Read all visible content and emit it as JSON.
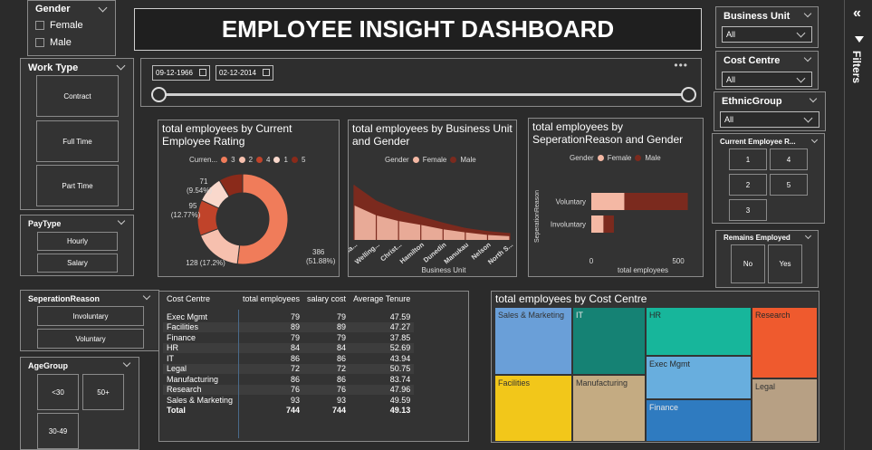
{
  "title": "EMPLOYEE INSIGHT DASHBOARD",
  "filters_pane": {
    "label": "Filters"
  },
  "gender": {
    "title": "Gender",
    "options": [
      "Female",
      "Male"
    ]
  },
  "work_type": {
    "title": "Work Type",
    "options": [
      "Contract",
      "Full Time",
      "Part Time"
    ]
  },
  "pay_type": {
    "title": "PayType",
    "options": [
      "Hourly",
      "Salary"
    ]
  },
  "separation_slicer": {
    "title": "SeperationReason",
    "options": [
      "Involuntary",
      "Voluntary"
    ]
  },
  "age_group": {
    "title": "AgeGroup",
    "options": [
      "<30",
      "50+",
      "30-49"
    ]
  },
  "date_range": {
    "start": "09-12-1966",
    "end": "02-12-2014"
  },
  "business_unit": {
    "title": "Business Unit",
    "value": "All"
  },
  "cost_centre": {
    "title": "Cost Centre",
    "value": "All"
  },
  "ethnic_group": {
    "title": "EthnicGroup",
    "value": "All"
  },
  "rating_slicer": {
    "title": "Current Employee R...",
    "options": [
      "1",
      "4",
      "2",
      "5",
      "3"
    ]
  },
  "remains_employed": {
    "title": "Remains Employed",
    "options": [
      "No",
      "Yes"
    ]
  },
  "colors": {
    "female": "#f4b8a4",
    "male": "#7b2a1e",
    "treemap": [
      "#6a9fd8",
      "#158274",
      "#17b69b",
      "#ef5a2e",
      "#c9b37f",
      "#c4ab82",
      "#68aede",
      "#2f7bc0",
      "#b7a084",
      "#f2c71a"
    ]
  },
  "chart_data": [
    {
      "type": "pie",
      "title": "total employees by Current Employee Rating",
      "legend_title": "Curren...",
      "legend": [
        "3",
        "2",
        "4",
        "1",
        "5"
      ],
      "slices": [
        {
          "label": "3",
          "value": 386,
          "pct": "51.88%",
          "color": "#f07c5a"
        },
        {
          "label": "2",
          "value": 128,
          "pct": "17.2%",
          "color": "#f6c0ae"
        },
        {
          "label": "4",
          "value": 95,
          "pct": "12.77%",
          "color": "#c0432a"
        },
        {
          "label": "1",
          "value": 71,
          "pct": "9.54%",
          "color": "#f9d8cc"
        },
        {
          "label": "5",
          "value": 64,
          "pct": "",
          "color": "#8a2a1a"
        }
      ],
      "data_labels": [
        "71",
        "(9.54%)",
        "95",
        "(12.77%)",
        "128 (17.2%)",
        "386",
        "(51.88%)"
      ]
    },
    {
      "type": "area",
      "title": "total employees by Business Unit and Gender",
      "legend_title": "Gender",
      "legend": [
        "Female",
        "Male"
      ],
      "xlabel": "Business Unit",
      "categories": [
        "Auckla...",
        "Welling...",
        "Christ...",
        "Hamilton",
        "Dunedin",
        "Manukau",
        "Nelson",
        "North S..."
      ],
      "series": [
        {
          "name": "Female",
          "values": [
            110,
            78,
            60,
            48,
            34,
            24,
            16,
            12
          ]
        },
        {
          "name": "Male",
          "values": [
            175,
            125,
            95,
            75,
            55,
            38,
            28,
            22
          ]
        }
      ]
    },
    {
      "type": "bar",
      "title": "total employees by SeperationReason and Gender",
      "legend_title": "Gender",
      "legend": [
        "Female",
        "Male"
      ],
      "xlabel": "total employees",
      "ylabel": "SeperationReason",
      "categories": [
        "Voluntary",
        "Involuntary"
      ],
      "series": [
        {
          "name": "Female",
          "values": [
            190,
            70
          ]
        },
        {
          "name": "Male",
          "values": [
            365,
            60
          ]
        }
      ],
      "xticks": [
        "0",
        "500"
      ],
      "xlim": [
        0,
        640
      ]
    },
    {
      "type": "table",
      "columns": [
        "Cost Centre",
        "total employees",
        "salary cost",
        "Average Tenure"
      ],
      "rows": [
        [
          "Exec Mgmt",
          "79",
          "79",
          "47.59"
        ],
        [
          "Facilities",
          "89",
          "89",
          "47.27"
        ],
        [
          "Finance",
          "79",
          "79",
          "37.85"
        ],
        [
          "HR",
          "84",
          "84",
          "52.69"
        ],
        [
          "IT",
          "86",
          "86",
          "43.94"
        ],
        [
          "Legal",
          "72",
          "72",
          "50.75"
        ],
        [
          "Manufacturing",
          "86",
          "86",
          "83.74"
        ],
        [
          "Research",
          "76",
          "76",
          "47.96"
        ],
        [
          "Sales & Marketing",
          "93",
          "93",
          "49.59"
        ]
      ],
      "total": [
        "Total",
        "744",
        "744",
        "49.13"
      ]
    },
    {
      "type": "treemap",
      "title": "total employees by Cost Centre",
      "cells": [
        {
          "label": "Sales & Marketing",
          "value": 93
        },
        {
          "label": "IT",
          "value": 86
        },
        {
          "label": "HR",
          "value": 84
        },
        {
          "label": "Research",
          "value": 76
        },
        {
          "label": "Facilities",
          "value": 89
        },
        {
          "label": "Manufacturing",
          "value": 86
        },
        {
          "label": "Exec Mgmt",
          "value": 79
        },
        {
          "label": "Finance",
          "value": 79
        },
        {
          "label": "Legal",
          "value": 72
        }
      ]
    }
  ]
}
